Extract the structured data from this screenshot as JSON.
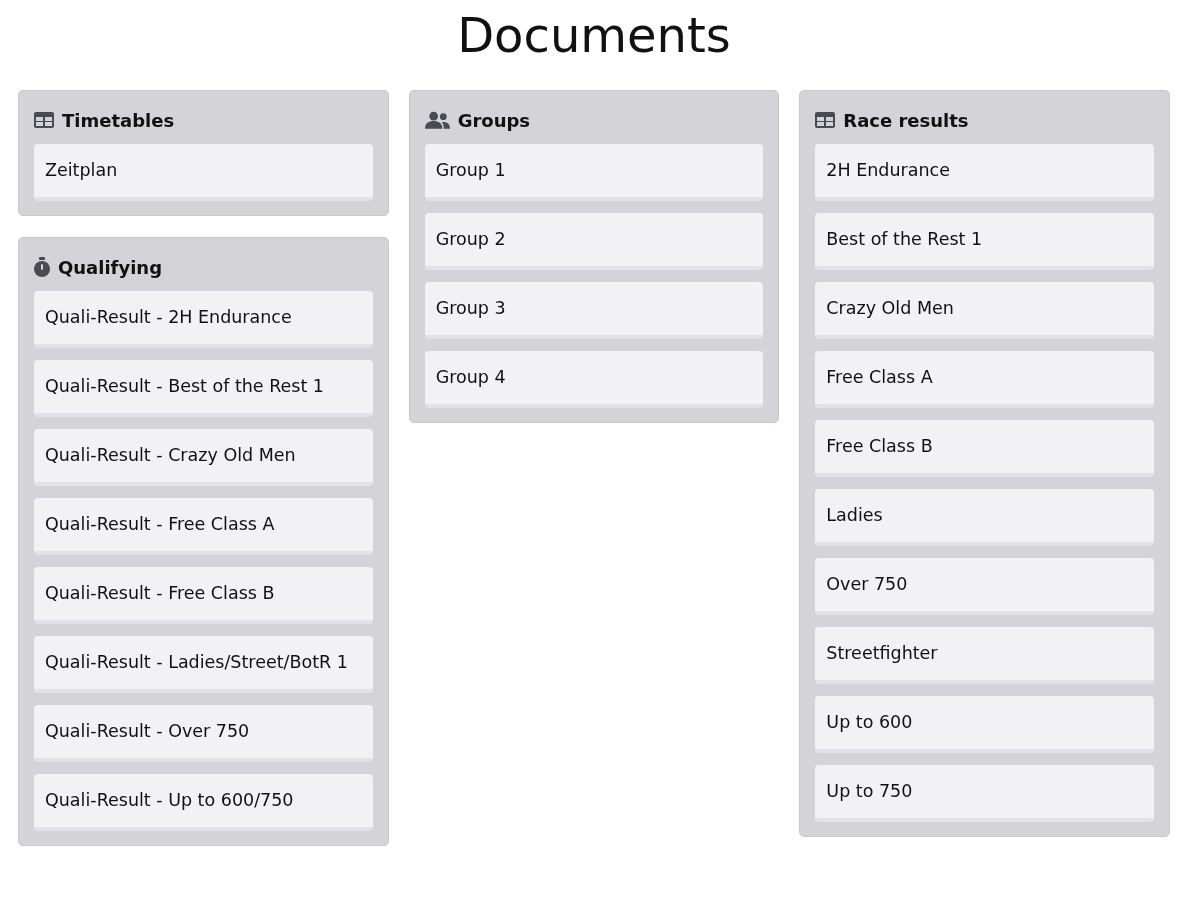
{
  "title": "Documents",
  "columns": [
    {
      "panels": [
        {
          "title": "Timetables",
          "kind": "table",
          "items": [
            "Zeitplan"
          ]
        },
        {
          "title": "Qualifying",
          "kind": "stopwatch",
          "items": [
            "Quali-Result - 2H Endurance",
            "Quali-Result - Best of the Rest 1",
            "Quali-Result - Crazy Old Men",
            "Quali-Result - Free Class A",
            "Quali-Result - Free Class B",
            "Quali-Result - Ladies/Street/BotR 1",
            "Quali-Result - Over 750",
            "Quali-Result - Up to 600/750"
          ]
        }
      ]
    },
    {
      "panels": [
        {
          "title": "Groups",
          "kind": "users",
          "items": [
            "Group 1",
            "Group 2",
            "Group 3",
            "Group 4"
          ]
        }
      ]
    },
    {
      "panels": [
        {
          "title": "Race results",
          "kind": "table",
          "items": [
            "2H Endurance",
            "Best of the Rest 1",
            "Crazy Old Men",
            "Free Class A",
            "Free Class B",
            "Ladies",
            "Over 750",
            "Streetfighter",
            "Up to 600",
            "Up to 750"
          ]
        }
      ]
    }
  ]
}
